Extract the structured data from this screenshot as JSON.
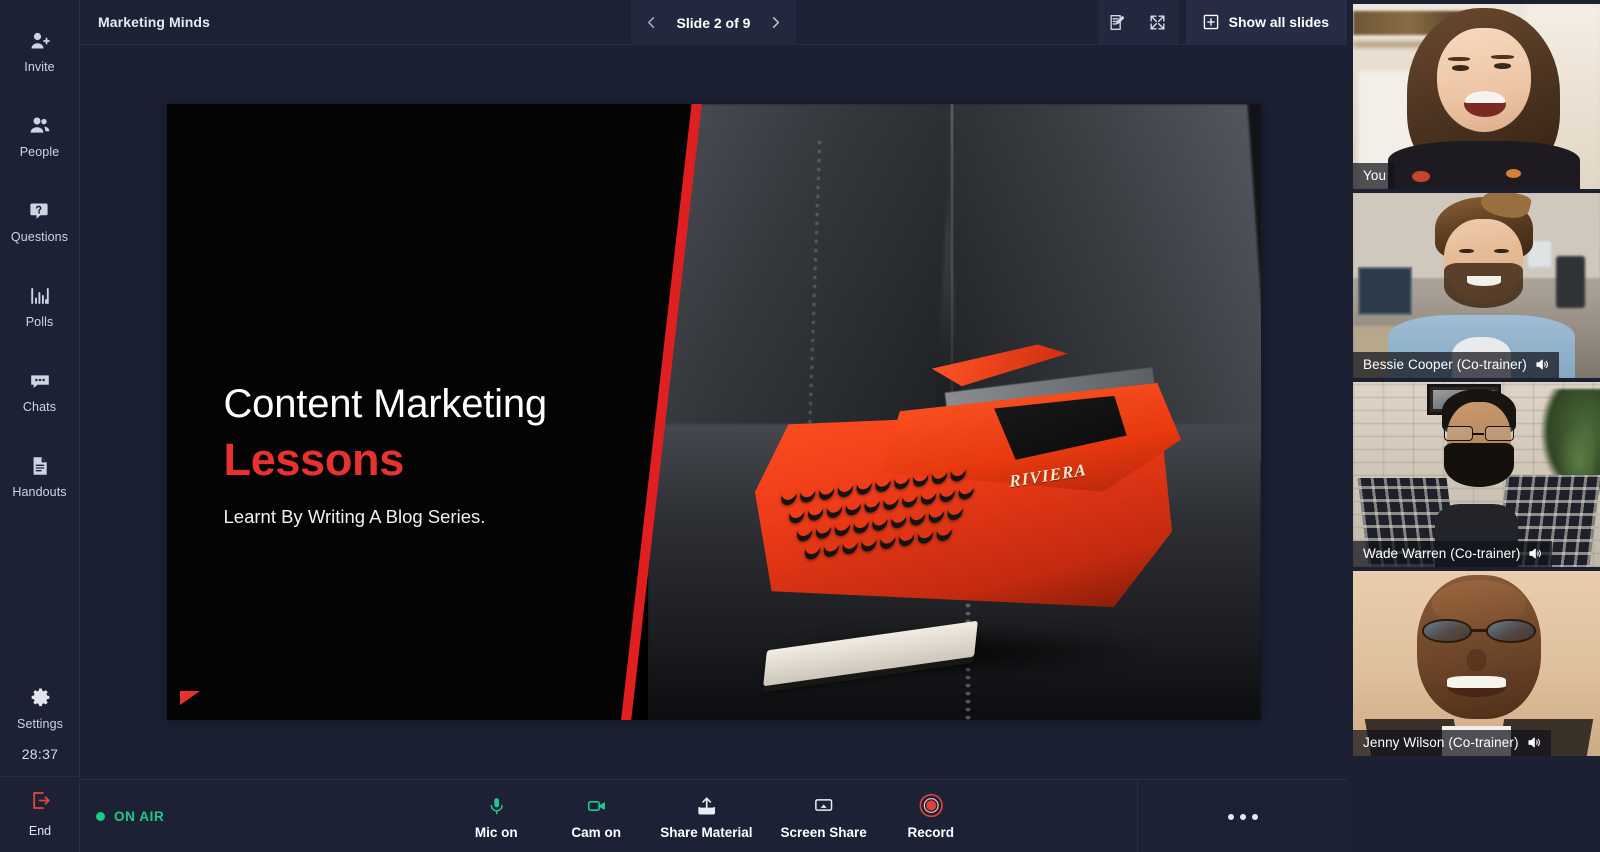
{
  "sidebar": {
    "items": [
      {
        "id": "invite",
        "label": "Invite",
        "icon": "person-add-icon"
      },
      {
        "id": "people",
        "label": "People",
        "icon": "people-icon"
      },
      {
        "id": "questions",
        "label": "Questions",
        "icon": "question-bubble-icon"
      },
      {
        "id": "polls",
        "label": "Polls",
        "icon": "bar-chart-icon"
      },
      {
        "id": "chats",
        "label": "Chats",
        "icon": "chat-bubble-icon"
      },
      {
        "id": "handouts",
        "label": "Handouts",
        "icon": "document-icon"
      }
    ],
    "settings": {
      "label": "Settings",
      "icon": "gear-icon"
    },
    "timer": "28:37",
    "end": {
      "label": "End",
      "icon": "exit-icon",
      "color": "#e0483f"
    }
  },
  "topbar": {
    "title": "Marketing Minds",
    "slide_label": "Slide 2 of 9",
    "prev_icon": "chevron-left-icon",
    "next_icon": "chevron-right-icon",
    "annotate_icon": "annotate-icon",
    "fullscreen_icon": "expand-arrows-icon",
    "show_all_slides": {
      "label": "Show all slides",
      "icon": "plus-box-icon"
    }
  },
  "slide": {
    "title": "Content Marketing",
    "accent": "Lessons",
    "subtitle": "Learnt By Writing A Blog Series.",
    "accent_color": "#e8322f",
    "background_color": "#000000",
    "photo_alt": "Red RIVIERA typewriter on a dark leather couch",
    "typewriter_brand": "RIVIERA"
  },
  "bottombar": {
    "status": {
      "label": "ON AIR",
      "color": "#1fc98a"
    },
    "controls": [
      {
        "id": "mic",
        "label": "Mic on",
        "icon": "microphone-icon",
        "color": "#1fc98a"
      },
      {
        "id": "cam",
        "label": "Cam on",
        "icon": "video-camera-icon",
        "color": "#1fc98a"
      },
      {
        "id": "share",
        "label": "Share Material",
        "icon": "upload-share-icon",
        "color": "#e9ecf3"
      },
      {
        "id": "screen",
        "label": "Screen Share",
        "icon": "monitor-icon",
        "color": "#e9ecf3"
      },
      {
        "id": "record",
        "label": "Record",
        "icon": "record-icon",
        "color": "#e2403a"
      }
    ],
    "more": {
      "label": "",
      "icon": "more-horizontal-icon"
    }
  },
  "participants": [
    {
      "id": "you",
      "name": "You",
      "muted_icon": "",
      "has_audio_icon": false
    },
    {
      "id": "bessie",
      "name": "Bessie Cooper (Co-trainer)",
      "muted_icon": "speaker-icon",
      "has_audio_icon": true
    },
    {
      "id": "wade",
      "name": "Wade Warren (Co-trainer)",
      "muted_icon": "speaker-icon",
      "has_audio_icon": true
    },
    {
      "id": "jenny",
      "name": "Jenny Wilson (Co-trainer)",
      "muted_icon": "speaker-icon",
      "has_audio_icon": true
    }
  ]
}
